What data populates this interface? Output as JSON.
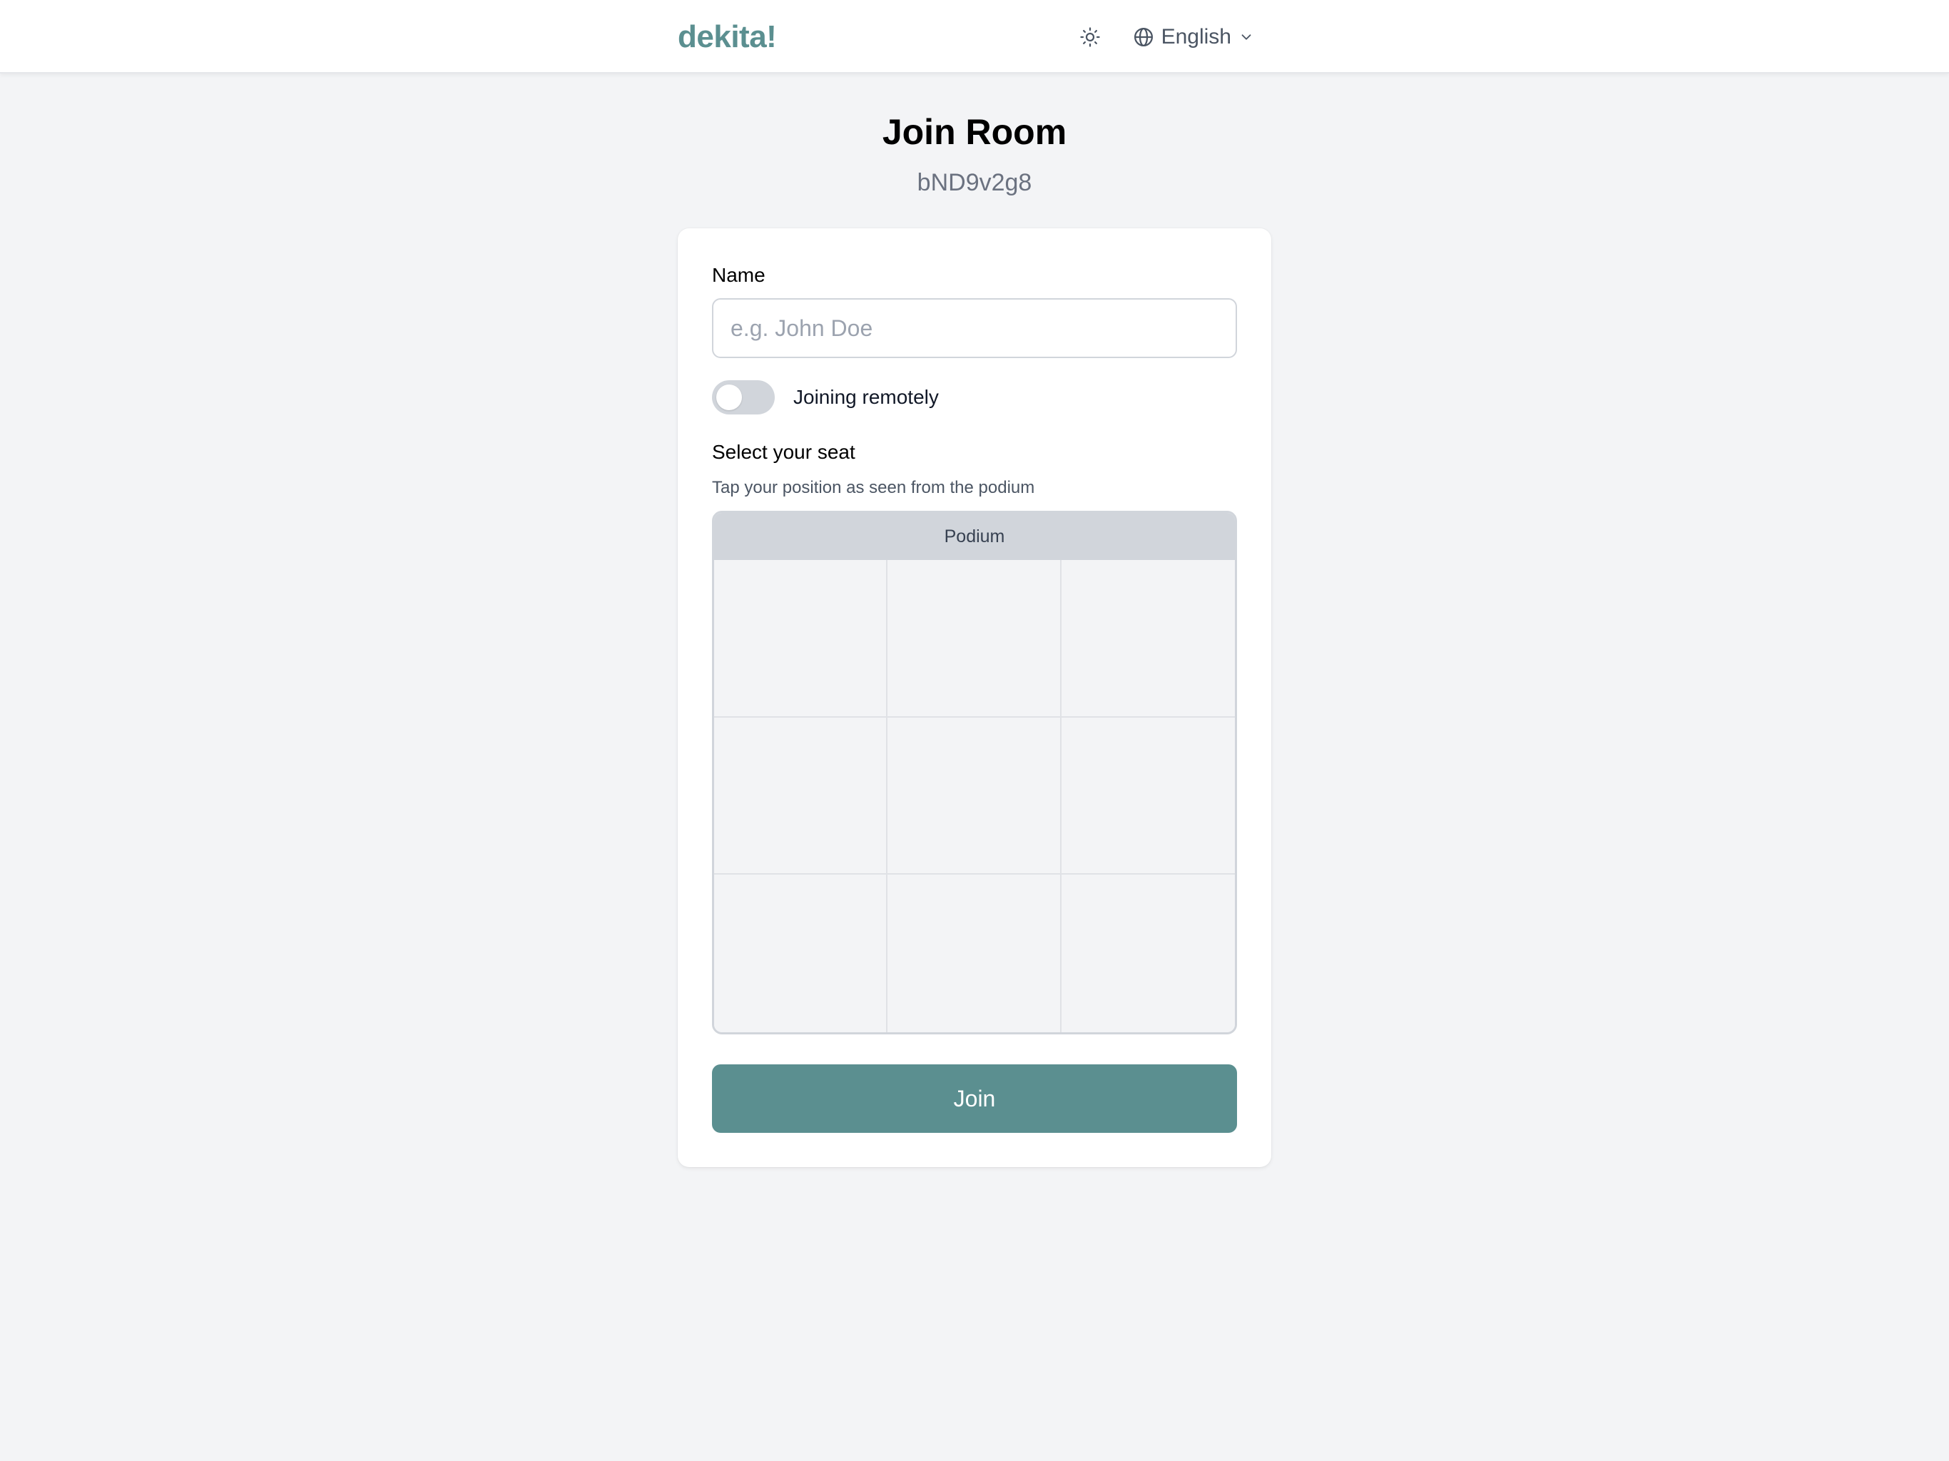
{
  "header": {
    "brand": "dekita!",
    "theme_icon": "sun-icon",
    "language": {
      "icon": "globe-icon",
      "selected": "English",
      "chevron_icon": "chevron-down-icon"
    }
  },
  "page": {
    "title": "Join Room",
    "room_code": "bND9v2g8"
  },
  "form": {
    "name_label": "Name",
    "name_value": "",
    "name_placeholder": "e.g. John Doe",
    "remote_toggle": {
      "label": "Joining remotely",
      "on": false
    },
    "seat": {
      "label": "Select your seat",
      "hint": "Tap your position as seen from the podium",
      "podium_label": "Podium",
      "rows": 3,
      "columns": 3
    },
    "join_label": "Join"
  },
  "colors": {
    "accent": "#5b8f90",
    "background": "#f3f4f6",
    "podium": "#d1d5db",
    "toggle_off": "#d1d5db"
  }
}
